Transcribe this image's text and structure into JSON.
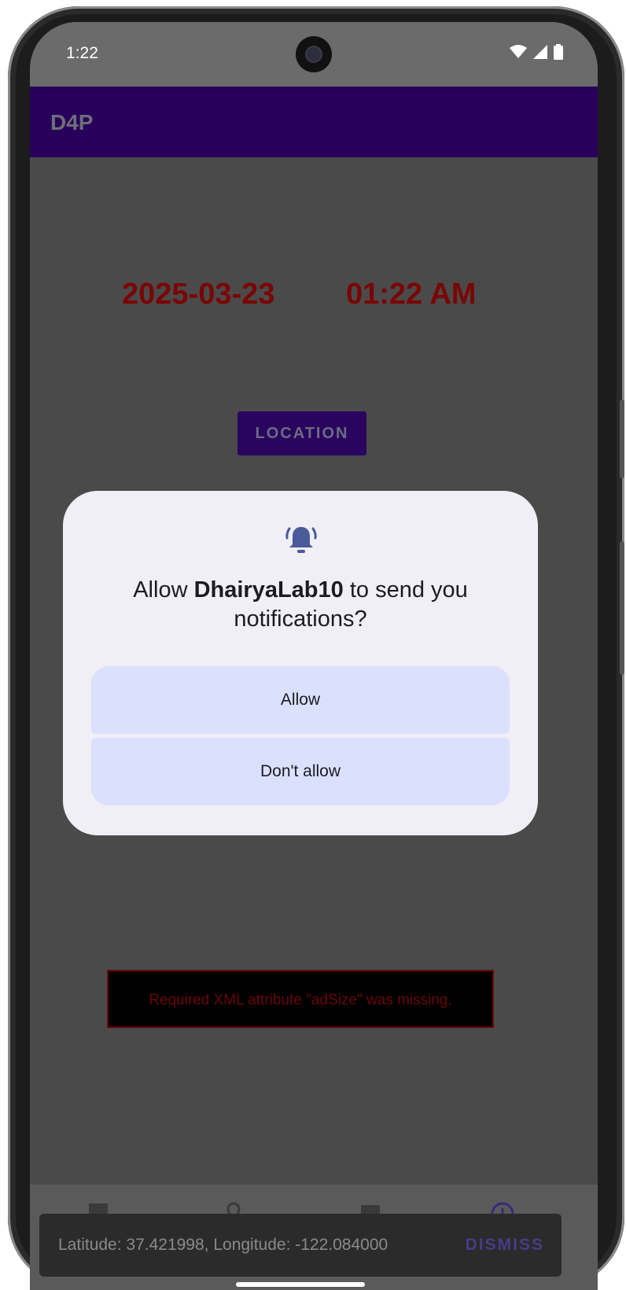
{
  "status_bar": {
    "time": "1:22"
  },
  "app_bar": {
    "title": "D4P"
  },
  "main": {
    "date": "2025-03-23",
    "time": "01:22 AM",
    "location_button": "LOCATION",
    "ad_error": "Required XML attribute \"adSize\" was missing."
  },
  "dialog": {
    "title_prefix": "Allow ",
    "app_name": "DhairyaLab10",
    "title_suffix": " to send you notifications?",
    "allow_label": "Allow",
    "deny_label": "Don't allow"
  },
  "snackbar": {
    "message": "Latitude: 37.421998, Longitude: -122.084000",
    "action": "DISMISS"
  },
  "colors": {
    "app_bar": "#28005c",
    "date_time_text": "#7a0505",
    "dialog_bg": "#f0eff6",
    "dialog_button_bg": "#dbe1fc",
    "icon_accent": "#4a5a9a"
  }
}
